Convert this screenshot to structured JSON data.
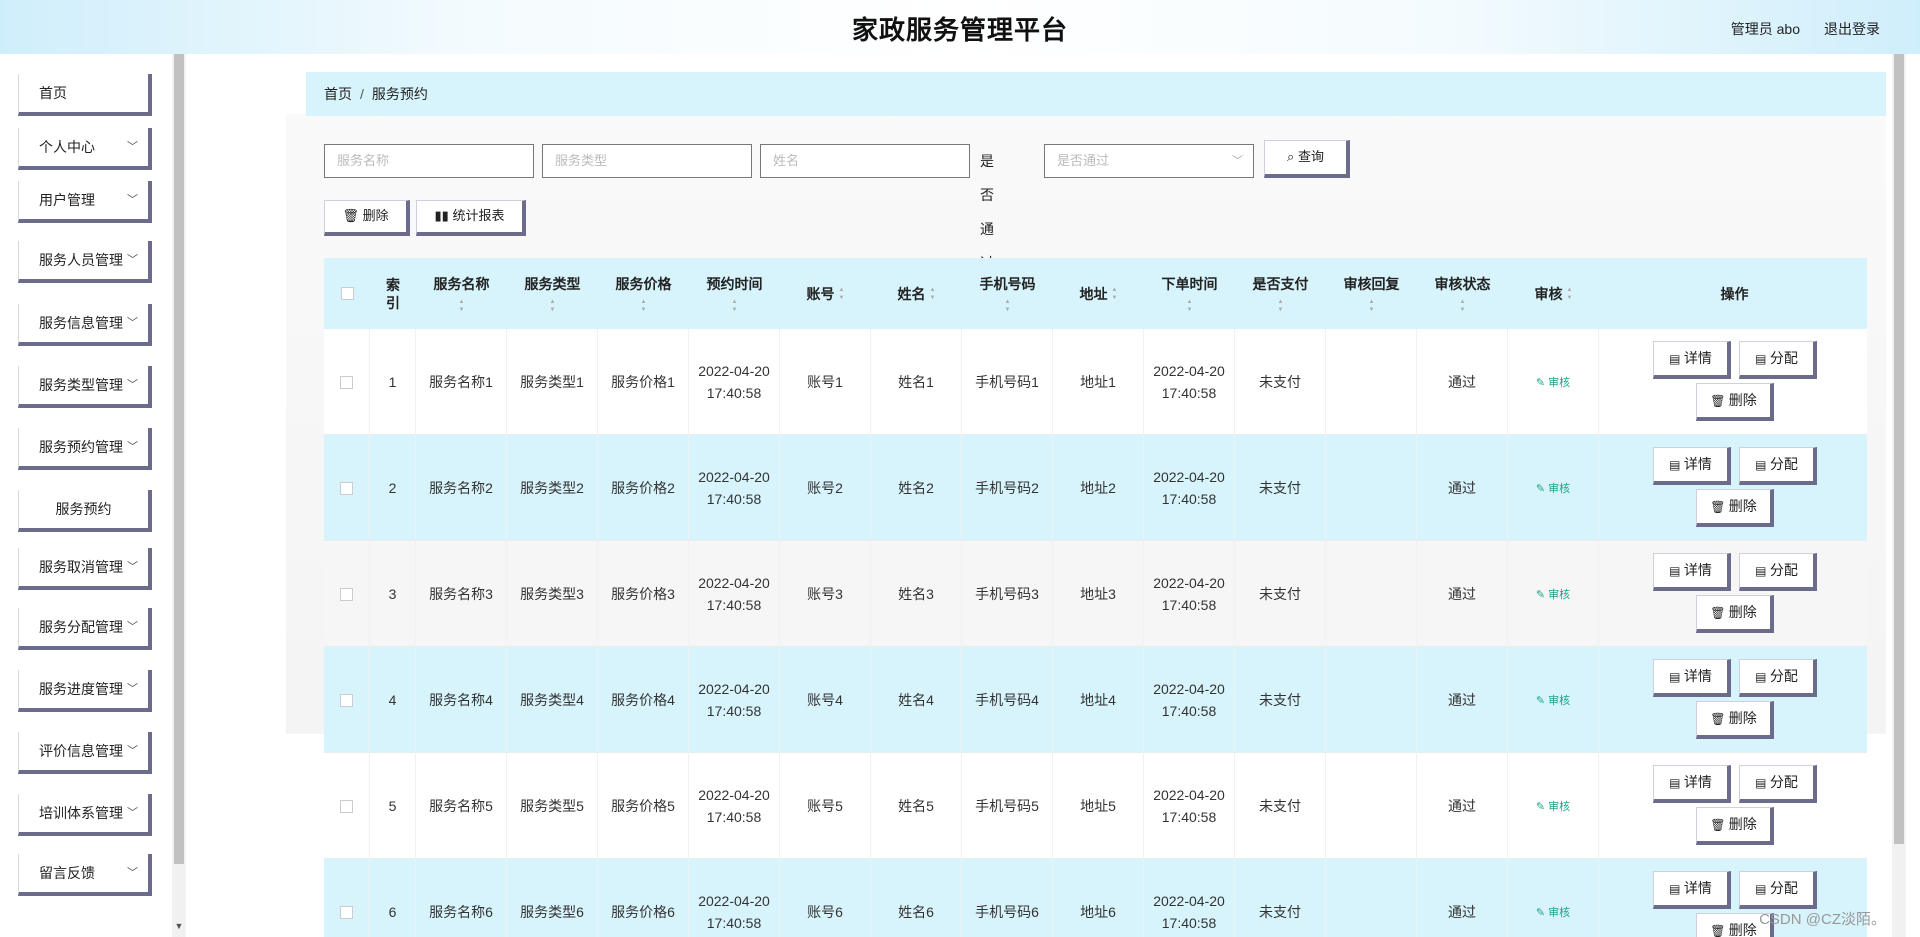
{
  "header": {
    "title": "家政服务管理平台",
    "user": "管理员 abo",
    "logout": "退出登录"
  },
  "sidebar": {
    "items": [
      {
        "label": "首页",
        "has_children": false
      },
      {
        "label": "个人中心",
        "has_children": true
      },
      {
        "label": "用户管理",
        "has_children": true
      },
      {
        "label": "服务人员管理",
        "has_children": true
      },
      {
        "label": "服务信息管理",
        "has_children": true
      },
      {
        "label": "服务类型管理",
        "has_children": true
      },
      {
        "label": "服务预约管理",
        "has_children": true
      },
      {
        "label": "服务预约",
        "has_children": false,
        "sub": true
      },
      {
        "label": "服务取消管理",
        "has_children": true
      },
      {
        "label": "服务分配管理",
        "has_children": true
      },
      {
        "label": "服务进度管理",
        "has_children": true
      },
      {
        "label": "评价信息管理",
        "has_children": true
      },
      {
        "label": "培训体系管理",
        "has_children": true
      },
      {
        "label": "留言反馈",
        "has_children": true
      }
    ]
  },
  "breadcrumb": {
    "home": "首页",
    "sep": "/",
    "current": "服务预约"
  },
  "search": {
    "service_name_placeholder": "服务名称",
    "service_type_placeholder": "服务类型",
    "name_placeholder": "姓名",
    "pass_label": "是否通过",
    "pass_placeholder": "是否通过",
    "query_label": "查询"
  },
  "actions": {
    "delete_label": "删除",
    "report_label": "统计报表"
  },
  "table": {
    "headers": {
      "index": "索引",
      "service_name": "服务名称",
      "service_type": "服务类型",
      "service_price": "服务价格",
      "appointment_time": "预约时间",
      "account": "账号",
      "name": "姓名",
      "phone": "手机号码",
      "address": "地址",
      "order_time": "下单时间",
      "paid": "是否支付",
      "audit_reply": "审核回复",
      "audit_status": "审核状态",
      "audit": "审核",
      "ops": "操作"
    },
    "rows": [
      {
        "index": "1",
        "service_name": "服务名称1",
        "service_type": "服务类型1",
        "service_price": "服务价格1",
        "appointment_time": "2022-04-20 17:40:58",
        "account": "账号1",
        "name": "姓名1",
        "phone": "手机号码1",
        "address": "地址1",
        "order_time": "2022-04-20 17:40:58",
        "paid": "未支付",
        "audit_reply": "",
        "audit_status": "通过",
        "audit_link": "审核"
      },
      {
        "index": "2",
        "service_name": "服务名称2",
        "service_type": "服务类型2",
        "service_price": "服务价格2",
        "appointment_time": "2022-04-20 17:40:58",
        "account": "账号2",
        "name": "姓名2",
        "phone": "手机号码2",
        "address": "地址2",
        "order_time": "2022-04-20 17:40:58",
        "paid": "未支付",
        "audit_reply": "",
        "audit_status": "通过",
        "audit_link": "审核"
      },
      {
        "index": "3",
        "service_name": "服务名称3",
        "service_type": "服务类型3",
        "service_price": "服务价格3",
        "appointment_time": "2022-04-20 17:40:58",
        "account": "账号3",
        "name": "姓名3",
        "phone": "手机号码3",
        "address": "地址3",
        "order_time": "2022-04-20 17:40:58",
        "paid": "未支付",
        "audit_reply": "",
        "audit_status": "通过",
        "audit_link": "审核"
      },
      {
        "index": "4",
        "service_name": "服务名称4",
        "service_type": "服务类型4",
        "service_price": "服务价格4",
        "appointment_time": "2022-04-20 17:40:58",
        "account": "账号4",
        "name": "姓名4",
        "phone": "手机号码4",
        "address": "地址4",
        "order_time": "2022-04-20 17:40:58",
        "paid": "未支付",
        "audit_reply": "",
        "audit_status": "通过",
        "audit_link": "审核"
      },
      {
        "index": "5",
        "service_name": "服务名称5",
        "service_type": "服务类型5",
        "service_price": "服务价格5",
        "appointment_time": "2022-04-20 17:40:58",
        "account": "账号5",
        "name": "姓名5",
        "phone": "手机号码5",
        "address": "地址5",
        "order_time": "2022-04-20 17:40:58",
        "paid": "未支付",
        "audit_reply": "",
        "audit_status": "通过",
        "audit_link": "审核"
      },
      {
        "index": "6",
        "service_name": "服务名称6",
        "service_type": "服务类型6",
        "service_price": "服务价格6",
        "appointment_time": "2022-04-20 17:40:58",
        "account": "账号6",
        "name": "姓名6",
        "phone": "手机号码6",
        "address": "地址6",
        "order_time": "2022-04-20 17:40:58",
        "paid": "未支付",
        "audit_reply": "",
        "audit_status": "通过",
        "audit_link": "审核"
      }
    ],
    "row_actions": {
      "detail": "详情",
      "assign": "分配",
      "delete": "删除"
    }
  },
  "watermark": "CSDN @CZ淡陌。",
  "colors": {
    "accent_light": "#d7f3fc",
    "button_shadow": "#6b6b8c",
    "audit_link": "#1aa58a"
  },
  "icons": {
    "dropdown": "chevron-down-icon",
    "sort": "sort-icon",
    "search": "search-icon",
    "delete": "trash-icon",
    "report": "bar-chart-icon",
    "detail": "document-icon",
    "edit": "edit-icon"
  }
}
